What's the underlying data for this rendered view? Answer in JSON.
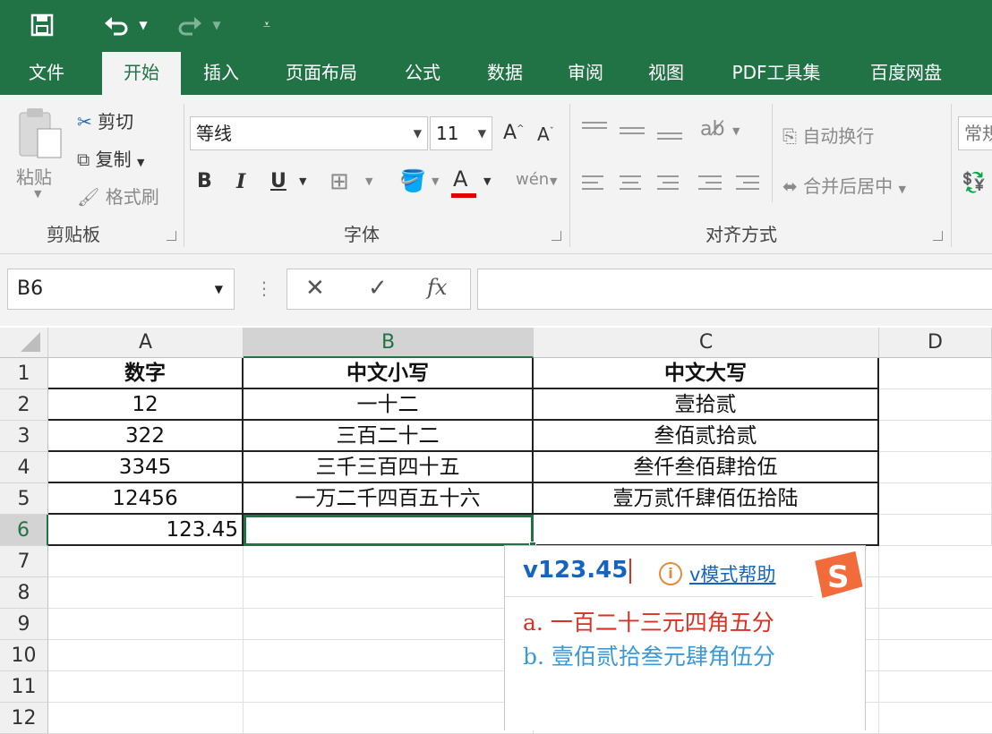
{
  "qat": {
    "save_icon": "save-icon",
    "undo_icon": "undo-icon",
    "redo_icon": "redo-icon",
    "customize_icon": "customize-icon"
  },
  "tabs": [
    {
      "label": "文件"
    },
    {
      "label": "开始"
    },
    {
      "label": "插入"
    },
    {
      "label": "页面布局"
    },
    {
      "label": "公式"
    },
    {
      "label": "数据"
    },
    {
      "label": "审阅"
    },
    {
      "label": "视图"
    },
    {
      "label": "PDF工具集"
    },
    {
      "label": "百度网盘"
    }
  ],
  "ribbon": {
    "clipboard": {
      "paste": "粘贴",
      "cut": "剪切",
      "copy": "复制",
      "format_painter": "格式刷",
      "group": "剪贴板"
    },
    "font": {
      "name": "等线",
      "size": "11",
      "grow": "A",
      "shrink": "A",
      "bold": "B",
      "italic": "I",
      "underline": "U",
      "font_color": "A",
      "phonetic": "wén",
      "group": "字体"
    },
    "alignment": {
      "wrap": "自动换行",
      "merge": "合并后居中",
      "group": "对齐方式"
    },
    "number": {
      "format": "常规"
    }
  },
  "formula_bar": {
    "name_box": "B6",
    "cancel": "✕",
    "enter": "✓",
    "fx": "fx",
    "content": ""
  },
  "columns": [
    "A",
    "B",
    "C",
    "D"
  ],
  "rows": [
    "1",
    "2",
    "3",
    "4",
    "5",
    "6",
    "7",
    "8",
    "9",
    "10",
    "11",
    "12"
  ],
  "table": [
    [
      "数字",
      "中文小写",
      "中文大写"
    ],
    [
      "12",
      "一十二",
      "壹拾贰"
    ],
    [
      "322",
      "三百二十二",
      "叁佰贰拾贰"
    ],
    [
      "3345",
      "三千三百四十五",
      "叁仟叁佰肆拾伍"
    ],
    [
      "12456",
      "一万二千四百五十六",
      "壹万贰仟肆佰伍拾陆"
    ],
    [
      "123.45",
      "",
      ""
    ]
  ],
  "ime": {
    "input": "v123.45",
    "help": "v模式帮助",
    "candidates": [
      "a. 一百二十三元四角五分",
      "b. 壹佰贰拾叁元肆角伍分"
    ],
    "colors": {
      "input": "#1565c0",
      "cand_a": "#d93025",
      "cand_b": "#3a9ad9",
      "logo": "#f26b3a"
    }
  },
  "colors": {
    "excel_green": "#217346"
  }
}
